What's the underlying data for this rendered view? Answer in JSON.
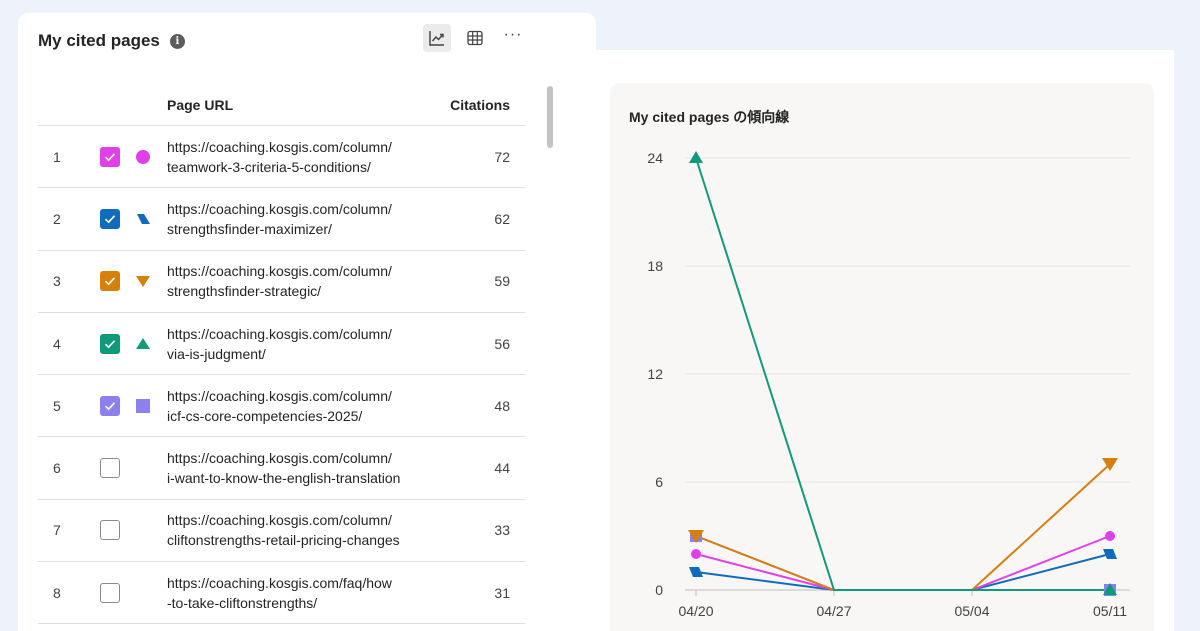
{
  "panel": {
    "title": "My cited pages",
    "info_icon": "info-icon",
    "toolbar": [
      "line-chart-icon",
      "table-icon",
      "more-icon"
    ],
    "more_label": "···"
  },
  "table": {
    "columns": {
      "url": "Page URL",
      "citations": "Citations"
    },
    "rows": [
      {
        "rank": "1",
        "checked": true,
        "color": "#e040e8",
        "marker": "circle",
        "url_line1": "https://coaching.kosgis.com/column/",
        "url_line2": "teamwork-3-criteria-5-conditions/",
        "citations": "72"
      },
      {
        "rank": "2",
        "checked": true,
        "color": "#0f6cbd",
        "marker": "parallelogram",
        "url_line1": "https://coaching.kosgis.com/column/",
        "url_line2": "strengthsfinder-maximizer/",
        "citations": "62"
      },
      {
        "rank": "3",
        "checked": true,
        "color": "#d67f0a",
        "marker": "triangle-down",
        "url_line1": "https://coaching.kosgis.com/column/",
        "url_line2": "strengthsfinder-strategic/",
        "citations": "59"
      },
      {
        "rank": "4",
        "checked": true,
        "color": "#0f9b7a",
        "marker": "triangle-up",
        "url_line1": "https://coaching.kosgis.com/column/",
        "url_line2": "via-is-judgment/",
        "citations": "56"
      },
      {
        "rank": "5",
        "checked": true,
        "color": "#8b80ee",
        "marker": "square",
        "url_line1": "https://coaching.kosgis.com/column/",
        "url_line2": "icf-cs-core-competencies-2025/",
        "citations": "48"
      },
      {
        "rank": "6",
        "checked": false,
        "color": "",
        "marker": "",
        "url_line1": "https://coaching.kosgis.com/column/",
        "url_line2": "i-want-to-know-the-english-translation",
        "citations": "44"
      },
      {
        "rank": "7",
        "checked": false,
        "color": "",
        "marker": "",
        "url_line1": "https://coaching.kosgis.com/column/",
        "url_line2": "cliftonstrengths-retail-pricing-changes",
        "citations": "33"
      },
      {
        "rank": "8",
        "checked": false,
        "color": "",
        "marker": "",
        "url_line1": "https://coaching.kosgis.com/faq/how",
        "url_line2": "-to-take-cliftonstrengths/",
        "citations": "31"
      }
    ]
  },
  "chart_data": {
    "type": "line",
    "title": "My cited pages の傾向線",
    "x": [
      "04/20",
      "04/27",
      "05/04",
      "05/11"
    ],
    "yticks": [
      0,
      6,
      12,
      18,
      24
    ],
    "ylim": [
      0,
      24
    ],
    "grid": true,
    "series": [
      {
        "color": "#0f9b7a",
        "marker": "triangle-up",
        "values": [
          24,
          0,
          0,
          0
        ]
      },
      {
        "color": "#d67f0a",
        "marker": "triangle-down",
        "values": [
          3,
          0,
          0,
          7
        ]
      },
      {
        "color": "#e040e8",
        "marker": "circle",
        "values": [
          2,
          0,
          0,
          3
        ]
      },
      {
        "color": "#0f6cbd",
        "marker": "parallelogram",
        "values": [
          1,
          0,
          0,
          2
        ]
      },
      {
        "color": "#8b80ee",
        "marker": "square",
        "values": [
          3,
          0,
          0,
          0
        ]
      }
    ]
  }
}
